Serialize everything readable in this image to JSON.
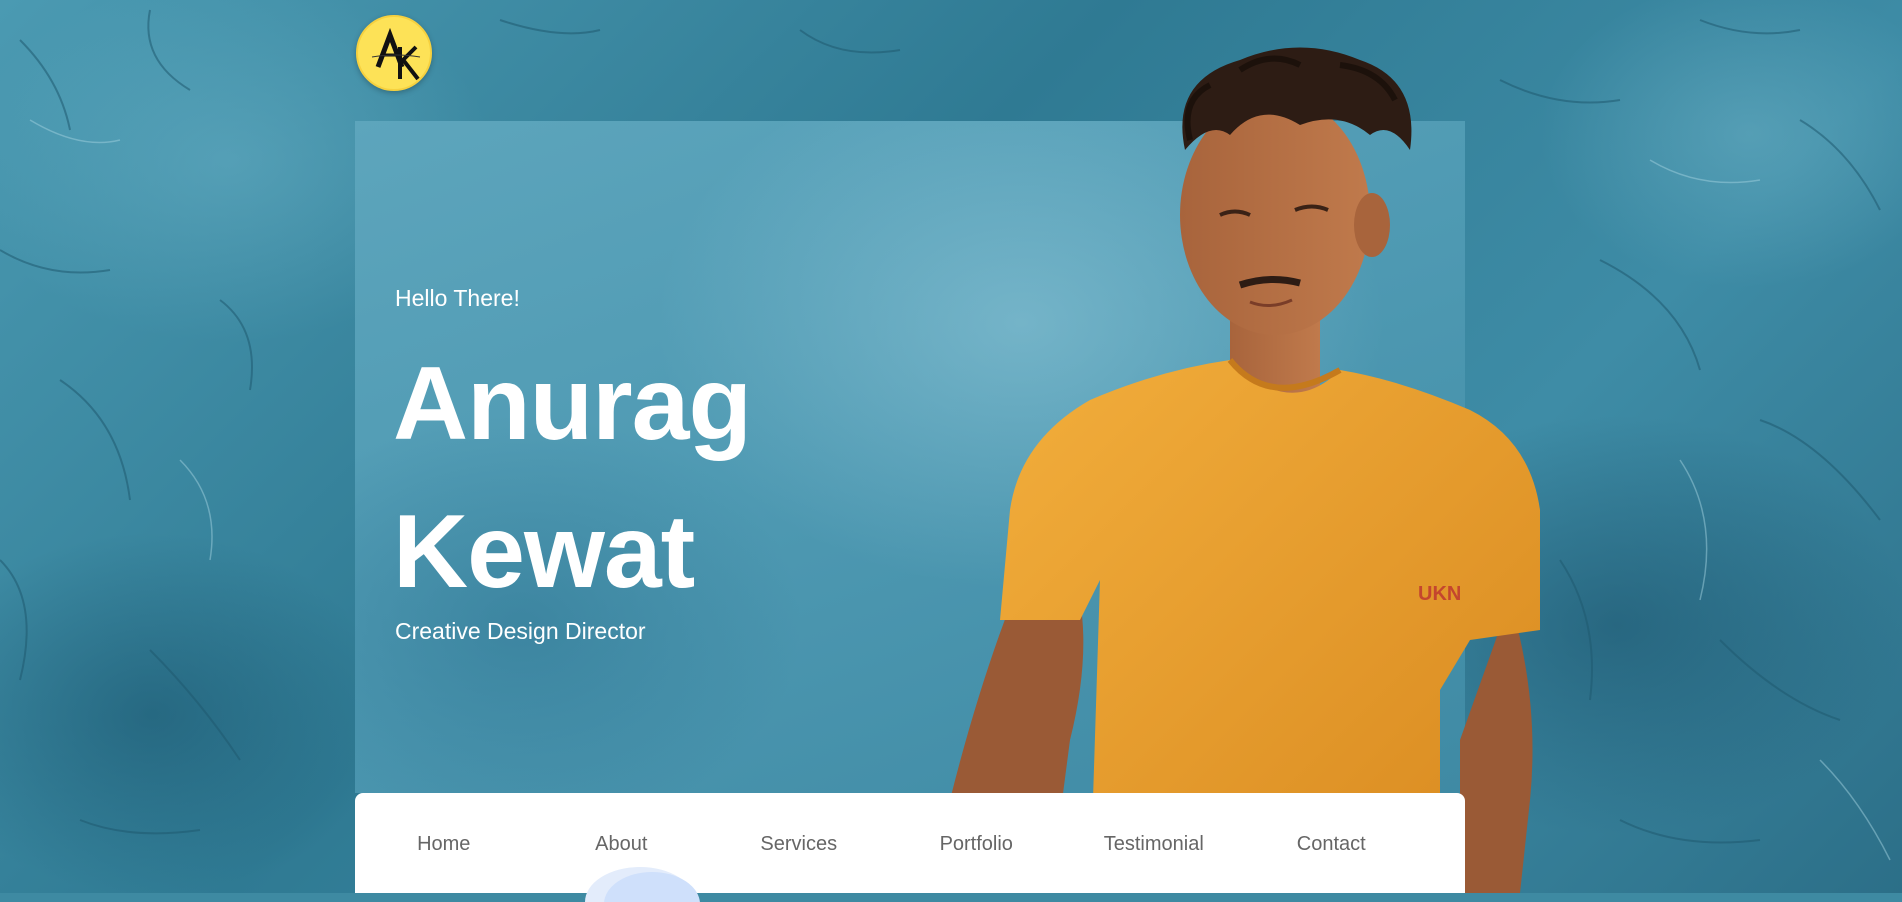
{
  "logo": {
    "letters": "AK",
    "script": "Anurag kewat"
  },
  "hero": {
    "greeting": "Hello There!",
    "first_name": "Anurag",
    "last_name": "Kewat",
    "role": "Creative Design Director",
    "shirt_logo": "UKN"
  },
  "nav": {
    "items": [
      {
        "label": "Home"
      },
      {
        "label": "About"
      },
      {
        "label": "Services"
      },
      {
        "label": "Portfolio"
      },
      {
        "label": "Testimonial"
      },
      {
        "label": "Contact"
      }
    ]
  },
  "colors": {
    "background": "#3e8aa2",
    "logo_yellow": "#fde257",
    "shirt_orange": "#eba12f",
    "nav_text": "#666666"
  }
}
